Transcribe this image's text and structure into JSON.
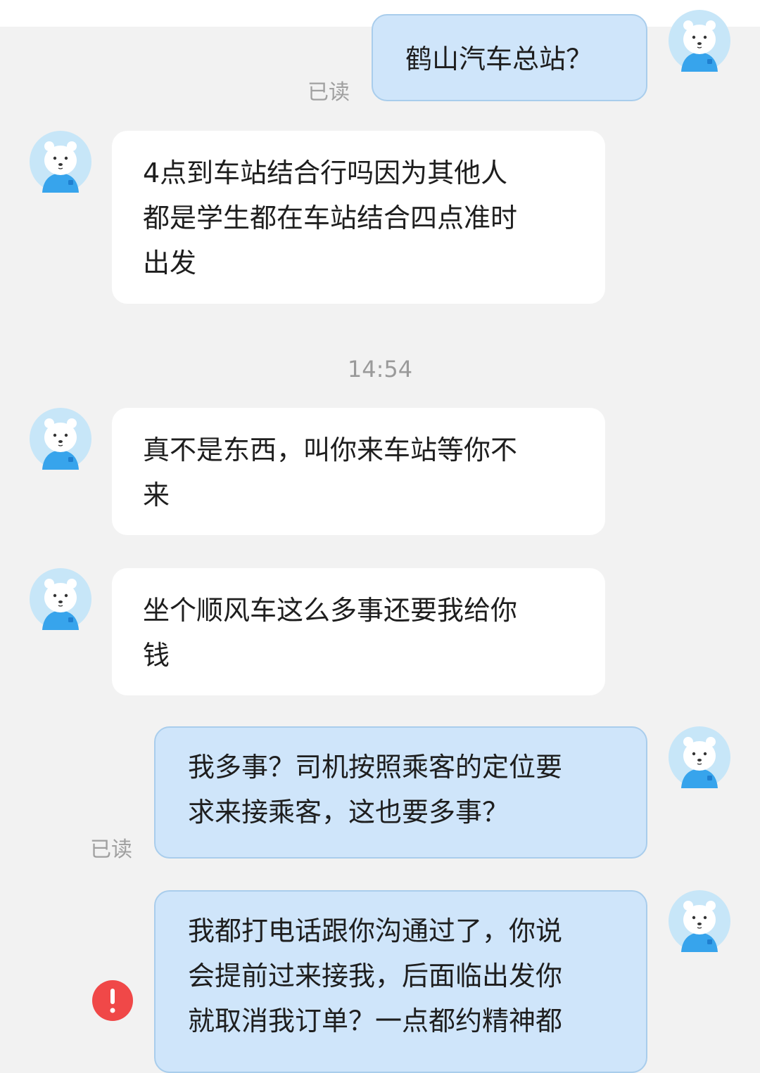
{
  "chat": {
    "colors": {
      "page_background": "#f2f2f2",
      "incoming_bubble": "#ffffff",
      "outgoing_bubble": "#cfe5fa",
      "outgoing_border": "#a9cdec",
      "read_receipt": "#a0a0a0",
      "error_badge": "#f04848"
    },
    "avatar_icon": "polar-bear-avatar-icon",
    "error_icon": "exclamation-icon",
    "messages": [
      {
        "direction": "outgoing",
        "text": "鹤山汽车总站？",
        "receipt": "已读"
      },
      {
        "direction": "incoming",
        "text": "4点到车站结合行吗因为其他人\n都是学生都在车站结合四点准时\n出发"
      },
      {
        "direction": "incoming",
        "text": "真不是东西，叫你来车站等你不\n来"
      },
      {
        "direction": "incoming",
        "text": "坐个顺风车这么多事还要我给你\n钱"
      },
      {
        "direction": "outgoing",
        "text": "我多事？司机按照乘客的定位要\n求来接乘客，这也要多事？",
        "receipt": "已读"
      },
      {
        "direction": "outgoing",
        "text": "我都打电话跟你沟通过了，你说\n会提前过来接我，后面临出发你\n就取消我订单？一点都约精神都",
        "status": "failed"
      }
    ],
    "timestamp": "14:54"
  }
}
